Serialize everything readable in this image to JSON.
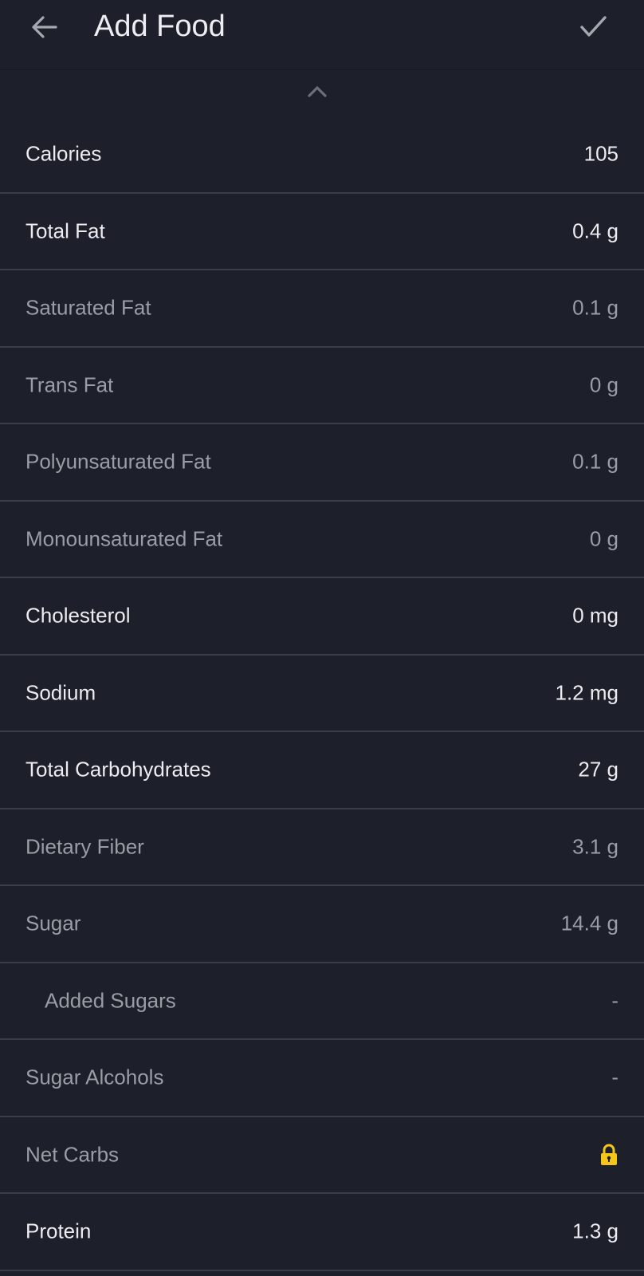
{
  "header": {
    "title": "Add Food",
    "back_icon": "arrow-left-icon",
    "confirm_icon": "checkmark-icon"
  },
  "collapse_icon": "chevron-up-icon",
  "nutrients": [
    {
      "label": "Calories",
      "value": "105",
      "style": "primary"
    },
    {
      "label": "Total Fat",
      "value": "0.4 g",
      "style": "primary"
    },
    {
      "label": "Saturated Fat",
      "value": "0.1 g",
      "style": "secondary"
    },
    {
      "label": "Trans Fat",
      "value": "0 g",
      "style": "secondary"
    },
    {
      "label": "Polyunsaturated Fat",
      "value": "0.1 g",
      "style": "secondary"
    },
    {
      "label": "Monounsaturated Fat",
      "value": "0 g",
      "style": "secondary"
    },
    {
      "label": "Cholesterol",
      "value": "0 mg",
      "style": "primary"
    },
    {
      "label": "Sodium",
      "value": "1.2 mg",
      "style": "primary"
    },
    {
      "label": "Total Carbohydrates",
      "value": "27 g",
      "style": "primary"
    },
    {
      "label": "Dietary Fiber",
      "value": "3.1 g",
      "style": "secondary"
    },
    {
      "label": "Sugar",
      "value": "14.4 g",
      "style": "secondary"
    },
    {
      "label": "Added Sugars",
      "value": "-",
      "style": "secondary",
      "indent": true
    },
    {
      "label": "Sugar Alcohols",
      "value": "-",
      "style": "secondary"
    },
    {
      "label": "Net Carbs",
      "value": null,
      "style": "secondary",
      "locked": true,
      "icon": "lock-icon"
    },
    {
      "label": "Protein",
      "value": "1.3 g",
      "style": "primary"
    }
  ],
  "colors": {
    "background": "#1d1f2a",
    "divider": "#3a3d4a",
    "primary_text": "#ececf0",
    "secondary_text": "#9a9ca6",
    "lock": "#f5c518"
  }
}
